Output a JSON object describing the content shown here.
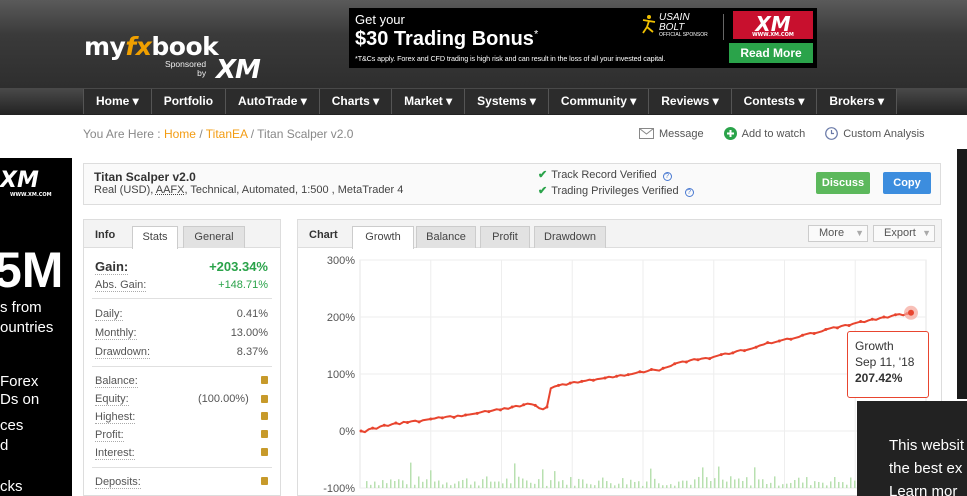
{
  "header": {
    "logo_pre": "my",
    "logo_fx": "fx",
    "logo_post": "book",
    "sponsored_line1": "Sponsored",
    "sponsored_line2": "by",
    "sponsor": "XM"
  },
  "banner": {
    "line1": "Get your",
    "line2": "$30 Trading Bonus",
    "line2_mark": "*",
    "disclaimer": "*T&Cs apply. Forex and CFD trading is high risk and can result in the loss of all your invested capital.",
    "ambassador_1": "USAIN",
    "ambassador_2": "BOLT",
    "ambassador_3": "OFFICIAL SPONSOR",
    "brand": "XM",
    "brand_url": "WWW.XM.COM",
    "cta": "Read More"
  },
  "nav": [
    "Home ▾",
    "Portfolio",
    "AutoTrade ▾",
    "Charts ▾",
    "Market ▾",
    "Systems ▾",
    "Community ▾",
    "Reviews ▾",
    "Contests ▾",
    "Brokers ▾"
  ],
  "breadcrumb": {
    "prefix": "You Are Here :",
    "home": "Home",
    "sep1": "/",
    "parent": "TitanEA",
    "sep2": "/",
    "current": "Titan Scalper v2.0"
  },
  "actions": {
    "message": "Message",
    "watch": "Add to watch",
    "analysis": "Custom Analysis"
  },
  "left_ad": {
    "brand": "XM",
    "url": "WWW.XM.COM",
    "big": "5M",
    "line1": "s from",
    "line2": "ountries",
    "line3": "Forex",
    "line4": "Ds on",
    "line5": "ces",
    "line6": "d",
    "line7": "cks"
  },
  "system": {
    "title": "Titan Scalper v2.0",
    "sub_pre": "Real (USD),",
    "sub_broker": "AAFX",
    "sub_post": ", Technical, Automated, 1:500 , MetaTrader 4",
    "verified1": "Track Record Verified",
    "verified2": "Trading Privileges Verified",
    "discuss": "Discuss",
    "copy": "Copy"
  },
  "info": {
    "title": "Info",
    "tabs": [
      "Stats",
      "General"
    ],
    "gain_label": "Gain:",
    "gain_value": "+203.34%",
    "abs_gain_label": "Abs. Gain:",
    "abs_gain_value": "+148.71%",
    "daily_label": "Daily:",
    "daily_value": "0.41%",
    "monthly_label": "Monthly:",
    "monthly_value": "13.00%",
    "drawdown_label": "Drawdown:",
    "drawdown_value": "8.37%",
    "balance_label": "Balance:",
    "equity_label": "Equity:",
    "equity_value": "(100.00%)",
    "highest_label": "Highest:",
    "profit_label": "Profit:",
    "interest_label": "Interest:",
    "deposits_label": "Deposits:"
  },
  "chart_panel": {
    "title": "Chart",
    "tabs": [
      "Growth",
      "Balance",
      "Profit",
      "Drawdown"
    ],
    "more": "More",
    "export": "Export",
    "tooltip_series": "Growth",
    "tooltip_date": "Sep 11, '18",
    "tooltip_value": "207.42%"
  },
  "chart_data": {
    "type": "line",
    "ylim": [
      -100,
      300
    ],
    "yticks": [
      "300%",
      "200%",
      "100%",
      "0%",
      "-100%"
    ],
    "yvalues": [
      300,
      200,
      100,
      0,
      -100
    ],
    "series": [
      {
        "values": [
          0,
          -2,
          3,
          5,
          4,
          8,
          10,
          9,
          12,
          14,
          12,
          16,
          15,
          17,
          18,
          16,
          19,
          20,
          21,
          22,
          24,
          23,
          25,
          26,
          24,
          27,
          26,
          28,
          29,
          30,
          31,
          33,
          35,
          34,
          36,
          38,
          37,
          40,
          39,
          42,
          44,
          43,
          46,
          48,
          47,
          45,
          40,
          38,
          42,
          75,
          78,
          80,
          82,
          81,
          84,
          86,
          85,
          87,
          88,
          90,
          89,
          91,
          92,
          93,
          95,
          94,
          96,
          98,
          97,
          99,
          100,
          102,
          104,
          103,
          105,
          108,
          107,
          106,
          110,
          112,
          114,
          118,
          120,
          122,
          121,
          124,
          126,
          125,
          127,
          128,
          127,
          130,
          132,
          134,
          136,
          135,
          137,
          140,
          142,
          141,
          143,
          145,
          147,
          150,
          152,
          155,
          154,
          156,
          158,
          160,
          162,
          161,
          163,
          165,
          168,
          170,
          172,
          171,
          173,
          175,
          178,
          180,
          182,
          181,
          184,
          186,
          185,
          188,
          190,
          192,
          191,
          194,
          196,
          195,
          198,
          200,
          199,
          202,
          204,
          205,
          203,
          206,
          207.42
        ]
      }
    ],
    "volume_bars": "light green histogram near -100% baseline"
  },
  "cookie": {
    "line1": "This websit",
    "line2": "the best ex",
    "line3": "Learn mor"
  },
  "colors": {
    "accent": "#f39c12",
    "gain_green": "#2aa34a",
    "line_red": "#e8452f",
    "copy_blue": "#3c8dde",
    "discuss_green": "#5cb85c",
    "xm_red": "#c8102e"
  }
}
